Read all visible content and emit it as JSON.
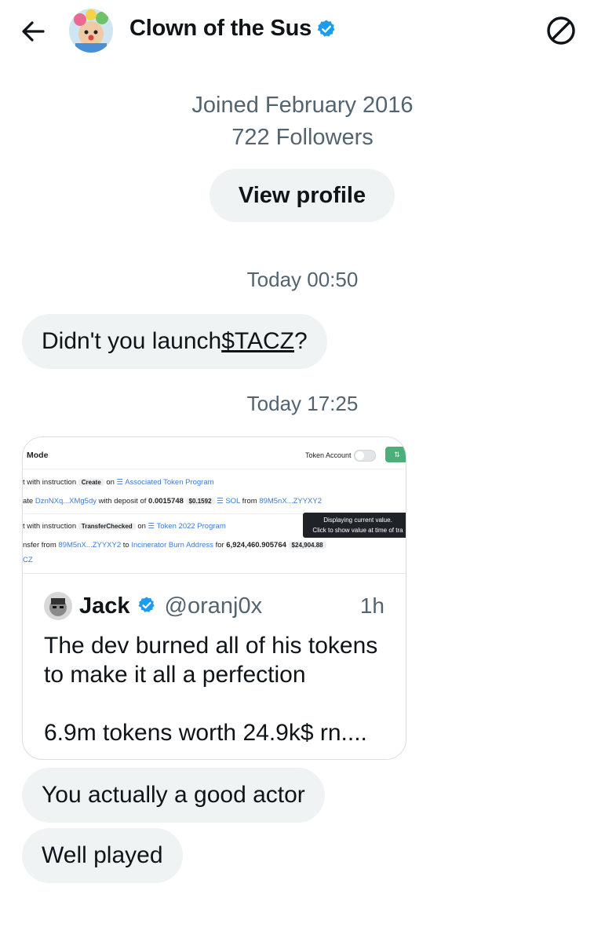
{
  "header": {
    "title": "Clown of the Sus",
    "verified": true,
    "back_icon": "arrow-left-icon",
    "block_icon": "block-icon"
  },
  "profile": {
    "joined": "Joined February 2016",
    "followers": "722 Followers",
    "view_profile_label": "View profile"
  },
  "messages": [
    {
      "timestamp": "Today 00:50"
    },
    {
      "text_before": "Didn't you launch ",
      "cashtag": "$TACZ",
      "text_after": "?"
    },
    {
      "timestamp": "Today 17:25"
    },
    {
      "text": "You actually a good actor"
    },
    {
      "text": "Well played"
    }
  ],
  "card": {
    "screenshot": {
      "mode": "Mode",
      "token_account": "Token Account",
      "row1_prefix": "t with instruction",
      "row1_pill": "Create",
      "row1_on": "on",
      "row1_program": "Associated Token Program",
      "row2_prefix": "ate",
      "row2_addr": "DznNXq...XMg5dy",
      "row2_deposit": "with deposit of",
      "row2_amount": "0.0015748",
      "row2_usd": "$0.1592",
      "row2_sol": "SOL",
      "row2_from": "from",
      "row2_from_addr": "89M5nX...ZYYXY2",
      "row3_prefix": "t with instruction",
      "row3_pill": "TransferChecked",
      "row3_on": "on",
      "row3_program": "Token 2022 Program",
      "row4_prefix": "nsfer from",
      "row4_addr": "89M5nX...ZYYXY2",
      "row4_to": "to",
      "row4_dest": "Incinerator Burn Address",
      "row4_for": "for",
      "row4_amount": "6,924,460.905764",
      "row4_usd": "$24,904.88",
      "row5": "CZ",
      "tooltip_line1": "Displaying current value.",
      "tooltip_line2": "Click to show value at time of tra"
    },
    "quote": {
      "name": "Jack",
      "verified": true,
      "handle": "@oranj0x",
      "time": "1h",
      "text": "The  dev burned all of his tokens\nto make it all a perfection\n\n6.9m  tokens worth 24.9k$ rn...."
    }
  },
  "colors": {
    "verified": "#1d9bf0",
    "bubble": "#eff3f4",
    "muted": "#536471"
  }
}
